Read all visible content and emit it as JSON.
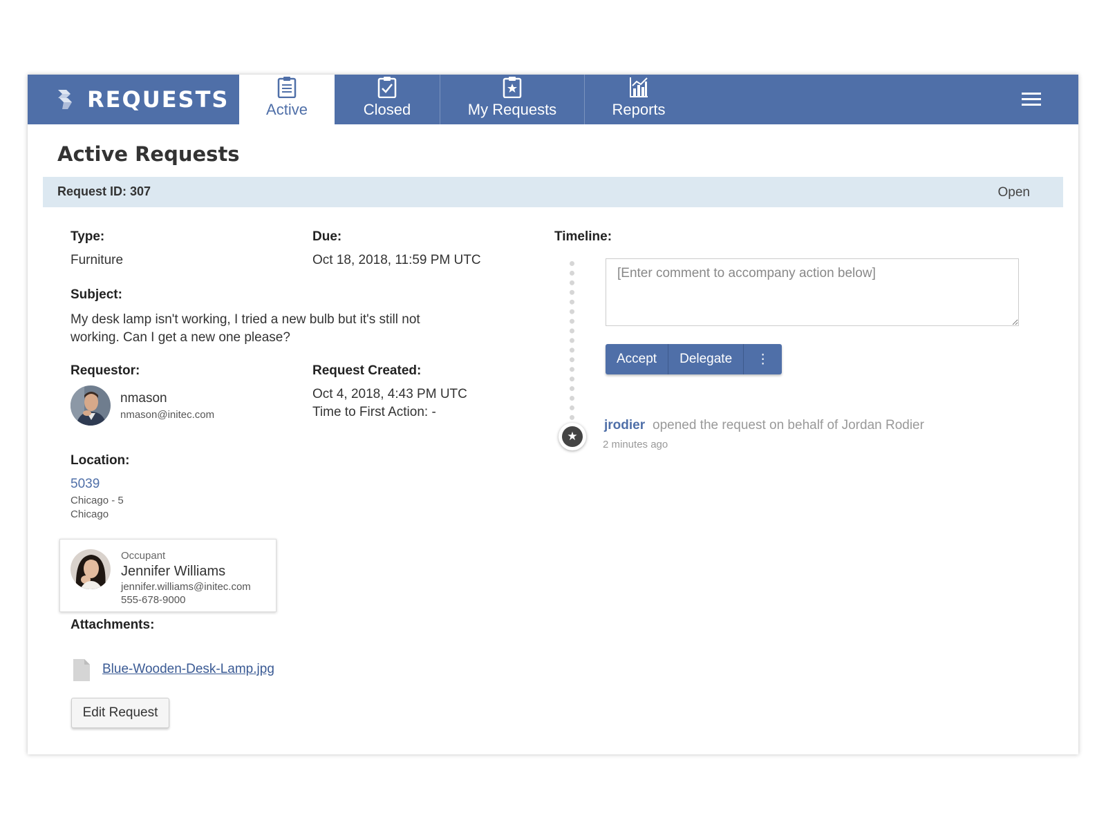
{
  "header": {
    "brand": "REQUESTS",
    "tabs": [
      {
        "label": "Active",
        "icon": "clipboard-list-icon",
        "active": true
      },
      {
        "label": "Closed",
        "icon": "clipboard-check-icon",
        "active": false
      },
      {
        "label": "My Requests",
        "icon": "clipboard-star-icon",
        "active": false
      },
      {
        "label": "Reports",
        "icon": "bar-chart-icon",
        "active": false
      }
    ],
    "menu_icon": "hamburger-menu-icon"
  },
  "page": {
    "title": "Active Requests"
  },
  "request": {
    "id_label": "Request ID: 307",
    "status": "Open",
    "type_label": "Type:",
    "type_value": "Furniture",
    "due_label": "Due:",
    "due_value": "Oct 18, 2018, 11:59 PM UTC",
    "subject_label": "Subject:",
    "subject_value": "My desk lamp isn't working, I tried a new bulb but it's still not working. Can I get a new one please?",
    "requestor_label": "Requestor:",
    "requestor_name": "nmason",
    "requestor_email": "nmason@initec.com",
    "created_label": "Request Created:",
    "created_value": "Oct 4, 2018, 4:43 PM UTC",
    "first_action": "Time to First Action: -",
    "location_label": "Location:",
    "location_code": "5039",
    "location_line1": "Chicago - 5",
    "location_line2": "Chicago",
    "occupant": {
      "role": "Occupant",
      "name": "Jennifer Williams",
      "email": "jennifer.williams@initec.com",
      "phone": "555-678-9000"
    },
    "attachments_label": "Attachments:",
    "attachment_file": "Blue-Wooden-Desk-Lamp.jpg",
    "edit_button": "Edit Request"
  },
  "timeline": {
    "label": "Timeline:",
    "comment_placeholder": "[Enter comment to accompany action below]",
    "accept_button": "Accept",
    "delegate_button": "Delegate",
    "more_button": "⋮",
    "event_user": "jrodier",
    "event_text": "opened the request on behalf of Jordan Rodier",
    "event_time": "2 minutes ago",
    "event_icon": "star-icon"
  },
  "colors": {
    "header_bg": "#4f6fa8",
    "id_bar_bg": "#dce8f1",
    "accent": "#4f6fa8"
  }
}
